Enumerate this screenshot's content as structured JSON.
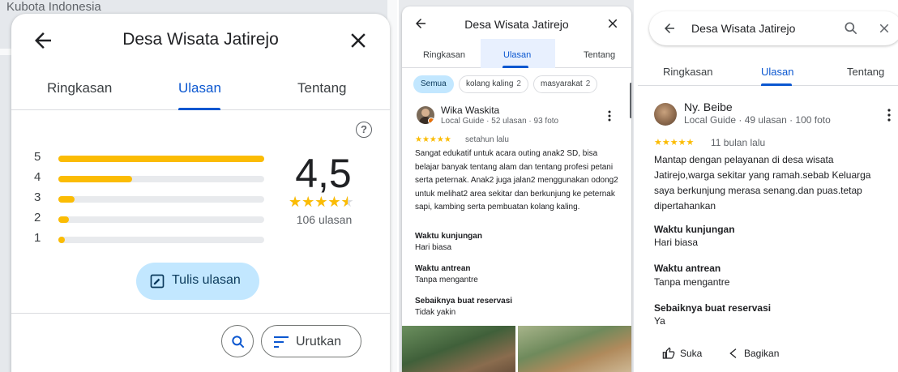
{
  "panel1": {
    "map_label": "Kubota Indonesia",
    "title": "Desa Wisata Jatirejo",
    "tabs": [
      "Ringkasan",
      "Ulasan",
      "Tentang"
    ],
    "active_tab": "Ulasan",
    "histogram": [
      {
        "stars": "5",
        "fraction": 1.0
      },
      {
        "stars": "4",
        "fraction": 0.36
      },
      {
        "stars": "3",
        "fraction": 0.08
      },
      {
        "stars": "2",
        "fraction": 0.05
      },
      {
        "stars": "1",
        "fraction": 0.03
      }
    ],
    "rating": "4,5",
    "stars": "★★★★★",
    "stars_filled": 4.5,
    "review_count": "106 ulasan",
    "write_review": "Tulis ulasan",
    "sort": "Urutkan"
  },
  "panel2": {
    "title": "Desa Wisata Jatirejo",
    "tabs": [
      "Ringkasan",
      "Ulasan",
      "Tentang"
    ],
    "active_tab": "Ulasan",
    "chips": [
      {
        "label": "Semua",
        "count": ""
      },
      {
        "label": "kolang kaling",
        "count": "2"
      },
      {
        "label": "masyarakat",
        "count": "2"
      }
    ],
    "reviewer": "Wika Waskita",
    "reviewer_meta": "Local Guide · 52 ulasan · 93 foto",
    "stars": "★★★★★",
    "when": "setahun lalu",
    "body": "Sangat edukatif untuk acara outing anak2 SD, bisa belajar banyak tentang alam dan tentang profesi petani serta peternak. Anak2 juga jalan2 menggunakan odong2 untuk melihat2 area sekitar dan berkunjung ke peternak sapi, kambing serta pembuatan kolang kaling.",
    "qa": [
      {
        "q": "Waktu kunjungan",
        "a": "Hari biasa"
      },
      {
        "q": "Waktu antrean",
        "a": "Tanpa mengantre"
      },
      {
        "q": "Sebaiknya buat reservasi",
        "a": "Tidak yakin"
      }
    ]
  },
  "panel3": {
    "search_text": "Desa Wisata Jatirejo",
    "tabs": [
      "Ringkasan",
      "Ulasan",
      "Tentang"
    ],
    "active_tab": "Ulasan",
    "reviewer": "Ny. Beibe",
    "reviewer_meta": "Local Guide · 49 ulasan · 100 foto",
    "stars": "★★★★★",
    "when": "11 bulan lalu",
    "body": "Mantap dengan pelayanan di desa wisata Jatirejo,warga sekitar yang ramah.sebab Keluarga saya berkunjung merasa senang.dan puas.tetap dipertahankan",
    "qa": [
      {
        "q": "Waktu kunjungan",
        "a": "Hari biasa"
      },
      {
        "q": "Waktu antrean",
        "a": "Tanpa mengantre"
      },
      {
        "q": "Sebaiknya buat reservasi",
        "a": "Ya"
      }
    ],
    "like": "Suka",
    "share": "Bagikan"
  },
  "colors": {
    "accent": "#0b57d0",
    "star": "#fbbc04",
    "chip_selected": "#c2e7ff",
    "track": "#e8eaed"
  }
}
